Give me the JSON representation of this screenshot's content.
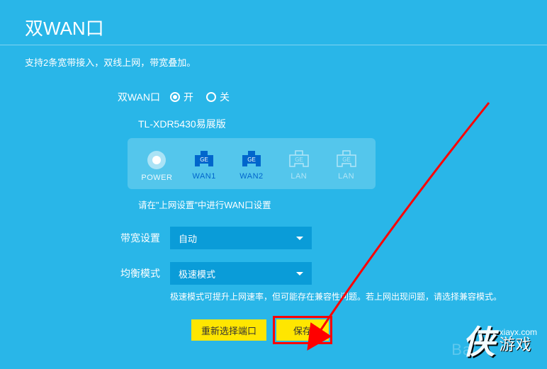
{
  "page": {
    "title": "双WAN口",
    "subtitle": "支持2条宽带接入，双线上网，带宽叠加。"
  },
  "toggle": {
    "label": "双WAN口",
    "on": "开",
    "off": "关",
    "selected": "on"
  },
  "device": {
    "model": "TL-XDR5430易展版"
  },
  "ports": {
    "power": "POWER",
    "wan1": "WAN1",
    "wan2": "WAN2",
    "lan1": "LAN",
    "lan2": "LAN",
    "ge": "GE"
  },
  "hints": {
    "wan_setup": "请在\"上网设置\"中进行WAN口设置",
    "mode": "极速模式可提升上网速率，但可能存在兼容性问题。若上网出现问题，请选择兼容模式。"
  },
  "bandwidth": {
    "label": "带宽设置",
    "value": "自动"
  },
  "balance": {
    "label": "均衡模式",
    "value": "极速模式"
  },
  "buttons": {
    "reselect": "重新选择端口",
    "save": "保存"
  },
  "watermark": {
    "bg": "Bai",
    "url": "xiayx.com",
    "brand": "游戏",
    "char": "侠"
  },
  "colors": {
    "bg": "#29b6e8",
    "panel": "#54c6ec",
    "select": "#0a9cd8",
    "btn": "#ffe600",
    "highlight": "#ff0000",
    "active_port": "#0066cc"
  }
}
